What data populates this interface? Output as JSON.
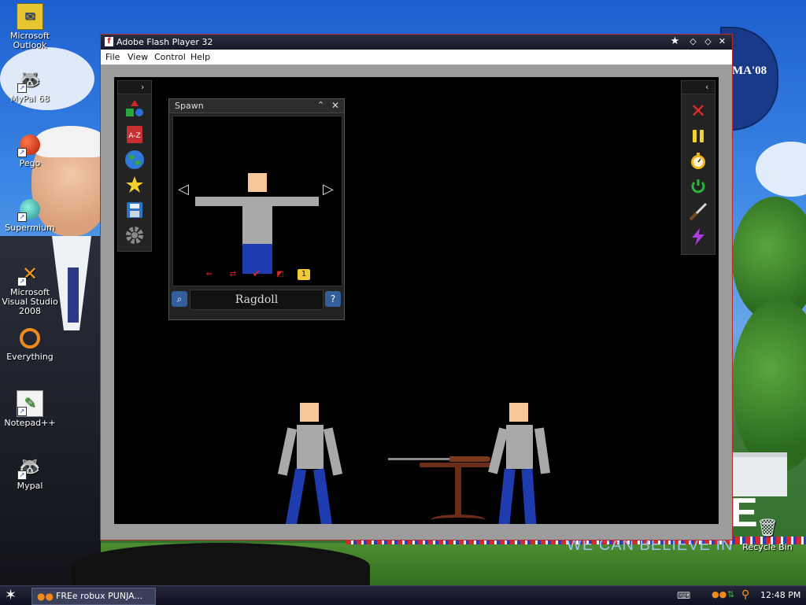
{
  "window": {
    "title": "Adobe Flash Player 32",
    "flash_icon": "f",
    "menu": [
      "File",
      "View",
      "Control",
      "Help"
    ]
  },
  "desktop_icons": [
    {
      "label": "Microsoft Outlook",
      "icon": "outlook-icon"
    },
    {
      "label": "MyPal 68",
      "icon": "raccoon-icon"
    },
    {
      "label": "Pego",
      "icon": "pego-icon"
    },
    {
      "label": "Supermium",
      "icon": "supermium-icon"
    },
    {
      "label": "Microsoft Visual Studio 2008",
      "icon": "visual-studio-icon"
    },
    {
      "label": "Everything",
      "icon": "everything-icon"
    },
    {
      "label": "Notepad++",
      "icon": "notepad-icon"
    },
    {
      "label": "Mypal",
      "icon": "raccoon-icon"
    },
    {
      "label": "Recycle Bin",
      "icon": "recycle-bin-icon"
    }
  ],
  "wallpaper": {
    "obama_text": "MA'08",
    "slogan": "WE CAN BELIEVE IN",
    "big_letter": "E"
  },
  "spawn_panel": {
    "title": "Spawn",
    "selected_name": "Ragdoll",
    "count_badge": "1",
    "prev_glyph": "◁",
    "next_glyph": "▷"
  },
  "taskbar": {
    "task_label": "FREe robux PUNJA...",
    "clock": "12:48 PM"
  },
  "colors": {
    "stage_bg": "#000000",
    "skin": "#f7c79a",
    "shirt": "#a9a9a9",
    "pants": "#1f3bb0",
    "table": "#6b2d17",
    "accent_red": "#d42727"
  }
}
